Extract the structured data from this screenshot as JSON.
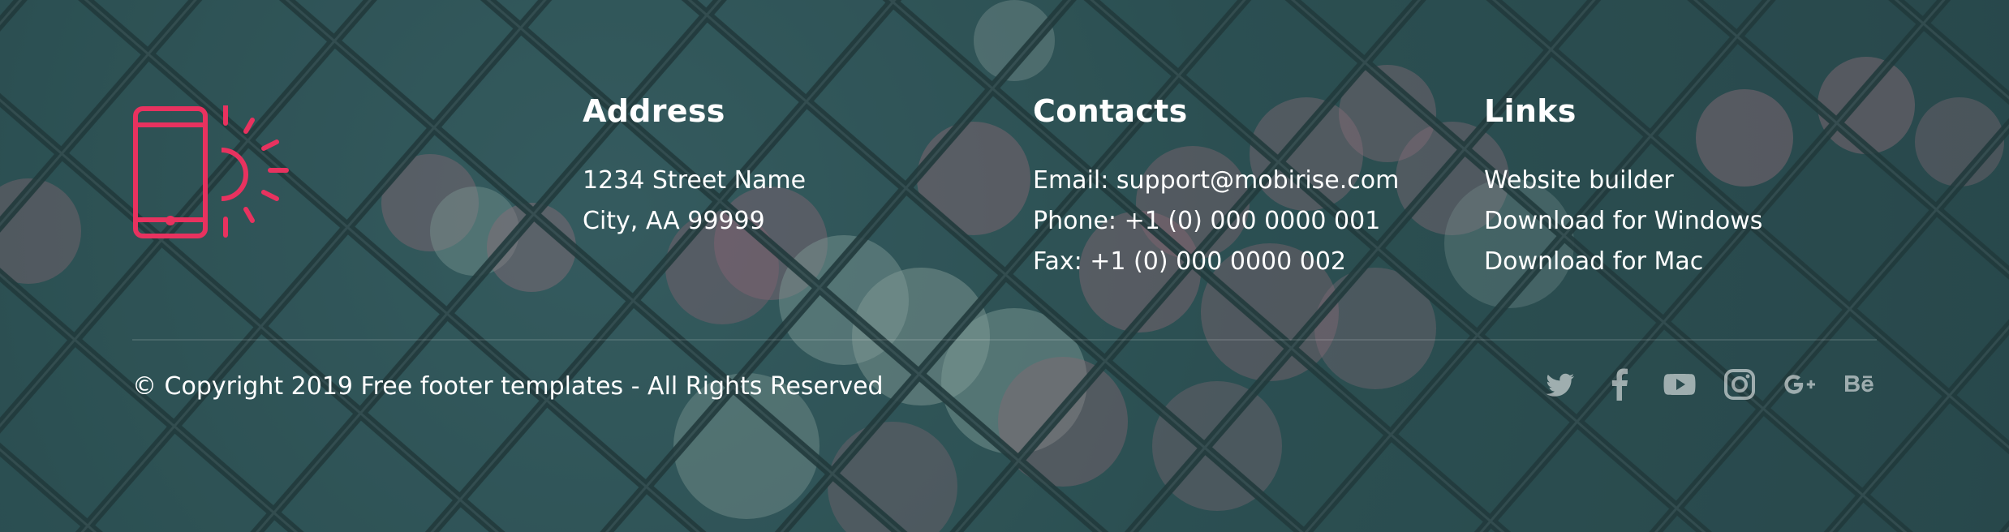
{
  "brand": {
    "logo_icon": "phone-with-sun-icon",
    "accent_color": "#e8325f"
  },
  "columns": {
    "address": {
      "title": "Address",
      "lines": [
        "1234 Street Name",
        "City, AA 99999"
      ]
    },
    "contacts": {
      "title": "Contacts",
      "lines": [
        "Email: support@mobirise.com",
        "Phone: +1 (0) 000 0000 001",
        "Fax: +1 (0) 000 0000 002"
      ]
    },
    "links": {
      "title": "Links",
      "items": [
        "Website builder",
        "Download for Windows",
        "Download for Mac"
      ]
    }
  },
  "copyright": "© Copyright 2019 Free footer templates - All Rights Reserved",
  "social": [
    {
      "icon": "twitter-icon"
    },
    {
      "icon": "facebook-icon"
    },
    {
      "icon": "youtube-icon"
    },
    {
      "icon": "instagram-icon"
    },
    {
      "icon": "google-plus-icon"
    },
    {
      "icon": "behance-icon"
    }
  ]
}
